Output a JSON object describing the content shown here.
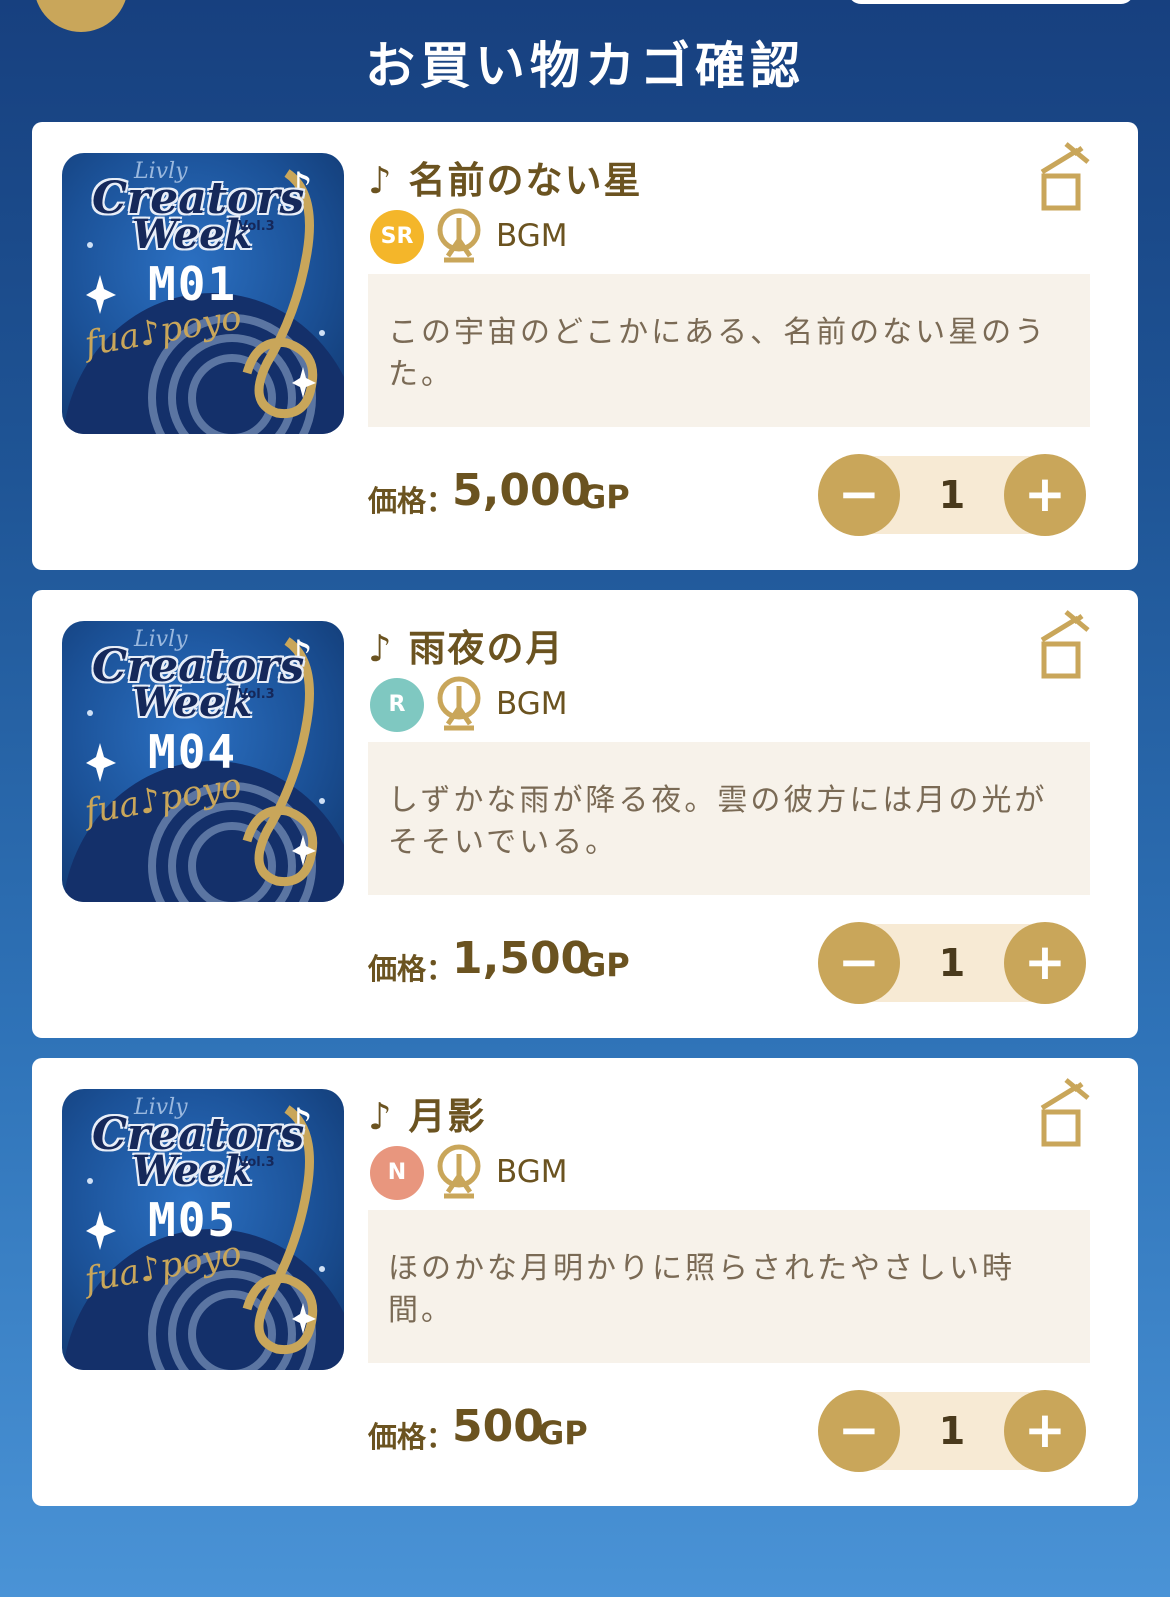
{
  "header": {
    "title": "お買い物カゴ確認"
  },
  "thumbnail_text": {
    "brand": "Livly",
    "line1": "Creators",
    "line2": "Week",
    "vol": "Vol.3",
    "artist": "fua♪poyo"
  },
  "items": [
    {
      "title": "♪ 名前のない星",
      "rarity": "SR",
      "category": "BGM",
      "description": "この宇宙のどこかにある、名前のない星のうた。",
      "code": "M01",
      "price_label": "価格：",
      "price": "5,000",
      "unit": "GP",
      "quantity": "1",
      "minus": "−",
      "plus": "+"
    },
    {
      "title": "♪ 雨夜の月",
      "rarity": "R",
      "category": "BGM",
      "description": "しずかな雨が降る夜。雲の彼方には月の光がそそいでいる。",
      "code": "M04",
      "price_label": "価格：",
      "price": "1,500",
      "unit": "GP",
      "quantity": "1",
      "minus": "−",
      "plus": "+"
    },
    {
      "title": "♪ 月影",
      "rarity": "N",
      "category": "BGM",
      "description": "ほのかな月明かりに照らされたやさしい時間。",
      "code": "M05",
      "price_label": "価格：",
      "price": "500",
      "unit": "GP",
      "quantity": "1",
      "minus": "−",
      "plus": "+"
    }
  ],
  "colors": {
    "gold": "#c9a65a",
    "brown_text": "#6b5320",
    "sr": "#f4b62a",
    "r": "#7fc8c1",
    "n": "#e8967e"
  }
}
